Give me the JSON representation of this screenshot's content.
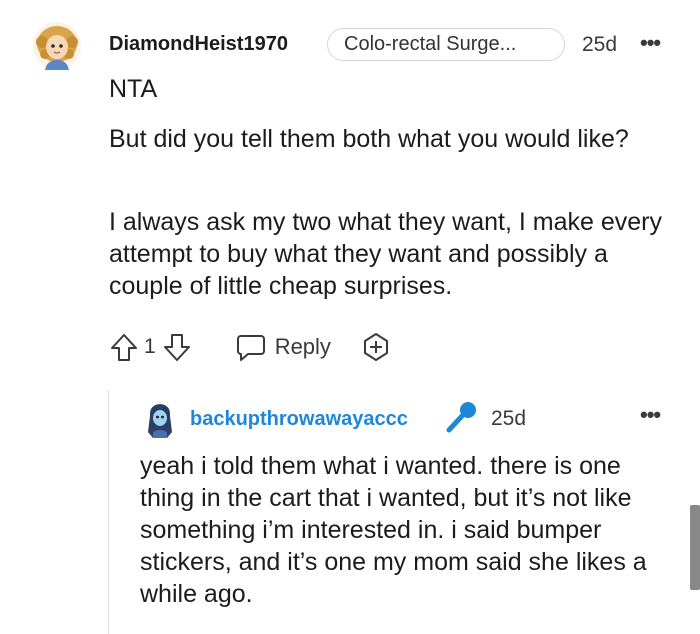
{
  "comment": {
    "username": "DiamondHeist1970",
    "flair": "Colo-rectal Surge...",
    "time": "25d",
    "more": "•••",
    "paragraphs": [
      "NTA",
      "But did you tell them both what you would like?",
      "I always ask my two what they want, I make every attempt to buy what they want and possibly a couple of little cheap surprises."
    ],
    "vote_count": "1",
    "reply_label": "Reply",
    "icons": [
      "upvote-icon",
      "downvote-icon",
      "reply-bubble-icon",
      "award-plus-icon",
      "more-options-icon"
    ]
  },
  "reply": {
    "username": "backupthrowawayaccc",
    "time": "25d",
    "more": "•••",
    "text": "yeah i told them what i wanted. there is one thing in the cart that i wanted, but it’s not like something i’m interested in. i said bumper stickers, and it’s one my mom said she likes a while ago.",
    "icons": [
      "microphone-icon",
      "more-options-icon"
    ]
  },
  "colors": {
    "text": "#1c1c1c",
    "meta": "#3a3a3a",
    "reply_username": "#1e88d8",
    "mic": "#1e88d8"
  }
}
